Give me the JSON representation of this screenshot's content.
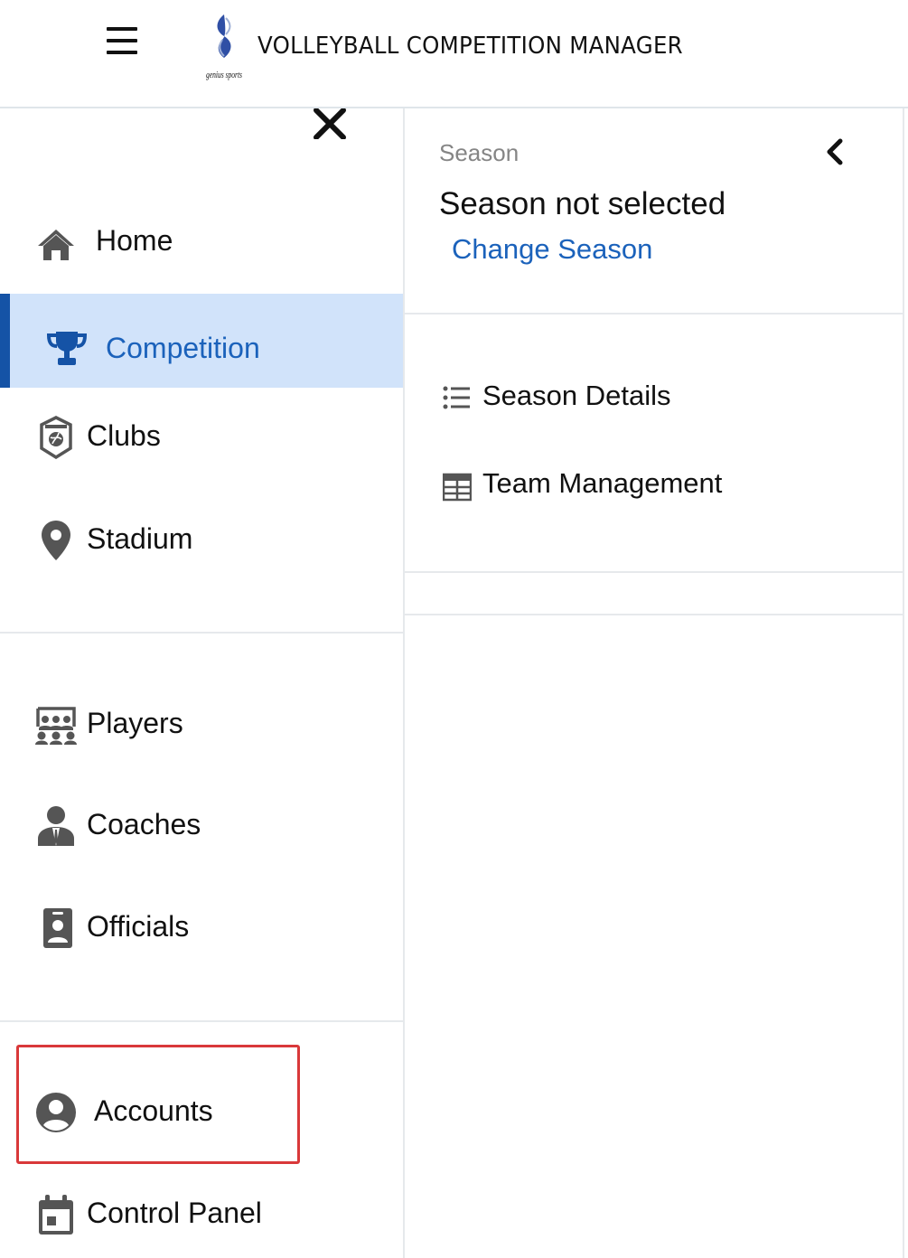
{
  "header": {
    "title": "VOLLEYBALL COMPETITION MANAGER",
    "menu_icon": "hamburger-icon",
    "logo": "genius-sports-logo",
    "logo_text": "genius sports"
  },
  "sidebar": {
    "close_icon": "close-icon",
    "active_color": "#1b62bb",
    "active_bg": "#d1e3fa",
    "items": [
      {
        "label": "Home",
        "icon": "home-icon"
      },
      {
        "label": "Competition",
        "icon": "trophy-icon",
        "active": true
      },
      {
        "label": "Clubs",
        "icon": "club-badge-icon"
      },
      {
        "label": "Stadium",
        "icon": "location-pin-icon"
      },
      {
        "label": "Players",
        "icon": "players-icon"
      },
      {
        "label": "Coaches",
        "icon": "coach-icon"
      },
      {
        "label": "Officials",
        "icon": "id-badge-icon"
      },
      {
        "label": "Accounts",
        "icon": "account-circle-icon",
        "highlighted": true
      },
      {
        "label": "Control Panel",
        "icon": "calendar-icon"
      }
    ]
  },
  "panel": {
    "season_label": "Season",
    "season_value": "Season not selected",
    "change_season": "Change Season",
    "collapse_icon": "chevron-left-icon",
    "menu": [
      {
        "label": "Season Details",
        "icon": "list-icon"
      },
      {
        "label": "Team Management",
        "icon": "table-icon"
      }
    ]
  }
}
